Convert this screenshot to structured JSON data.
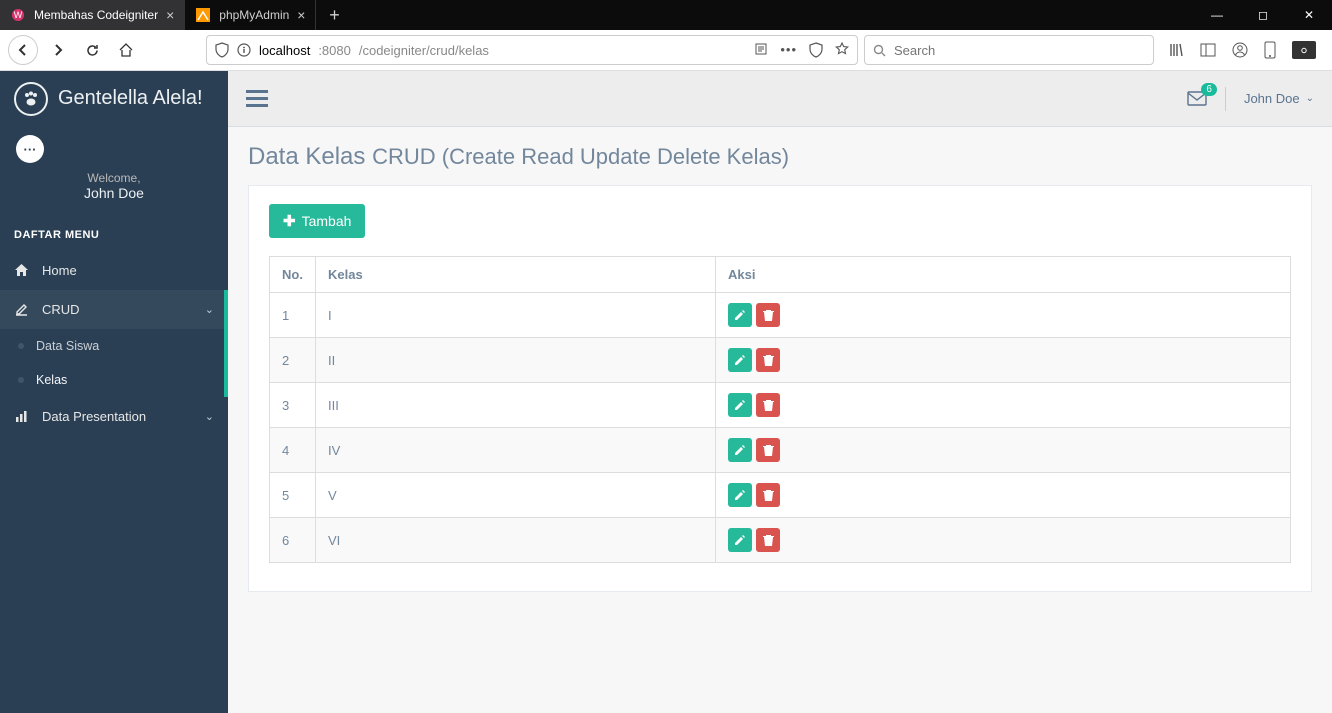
{
  "browser": {
    "tabs": [
      {
        "title": "Membahas Codeigniter",
        "active": true
      },
      {
        "title": "phpMyAdmin",
        "active": false
      }
    ],
    "url_host": "localhost",
    "url_port": ":8080",
    "url_path": "/codeigniter/crud/kelas",
    "search_placeholder": "Search"
  },
  "sidebar": {
    "brand": "Gentelella Alela!",
    "welcome": "Welcome,",
    "username": "John Doe",
    "section_title": "DAFTAR MENU",
    "items": [
      {
        "label": "Home"
      },
      {
        "label": "CRUD"
      },
      {
        "label": "Data Presentation"
      }
    ],
    "crud_sub": [
      {
        "label": "Data Siswa"
      },
      {
        "label": "Kelas"
      }
    ]
  },
  "topbar": {
    "mail_badge": "6",
    "user": "John Doe"
  },
  "page": {
    "title_main": "Data Kelas",
    "title_sub": "CRUD (Create Read Update Delete Kelas)",
    "add_button": "Tambah",
    "columns": {
      "no": "No.",
      "kelas": "Kelas",
      "aksi": "Aksi"
    },
    "rows": [
      {
        "no": "1",
        "kelas": "I"
      },
      {
        "no": "2",
        "kelas": "II"
      },
      {
        "no": "3",
        "kelas": "III"
      },
      {
        "no": "4",
        "kelas": "IV"
      },
      {
        "no": "5",
        "kelas": "V"
      },
      {
        "no": "6",
        "kelas": "VI"
      }
    ]
  }
}
